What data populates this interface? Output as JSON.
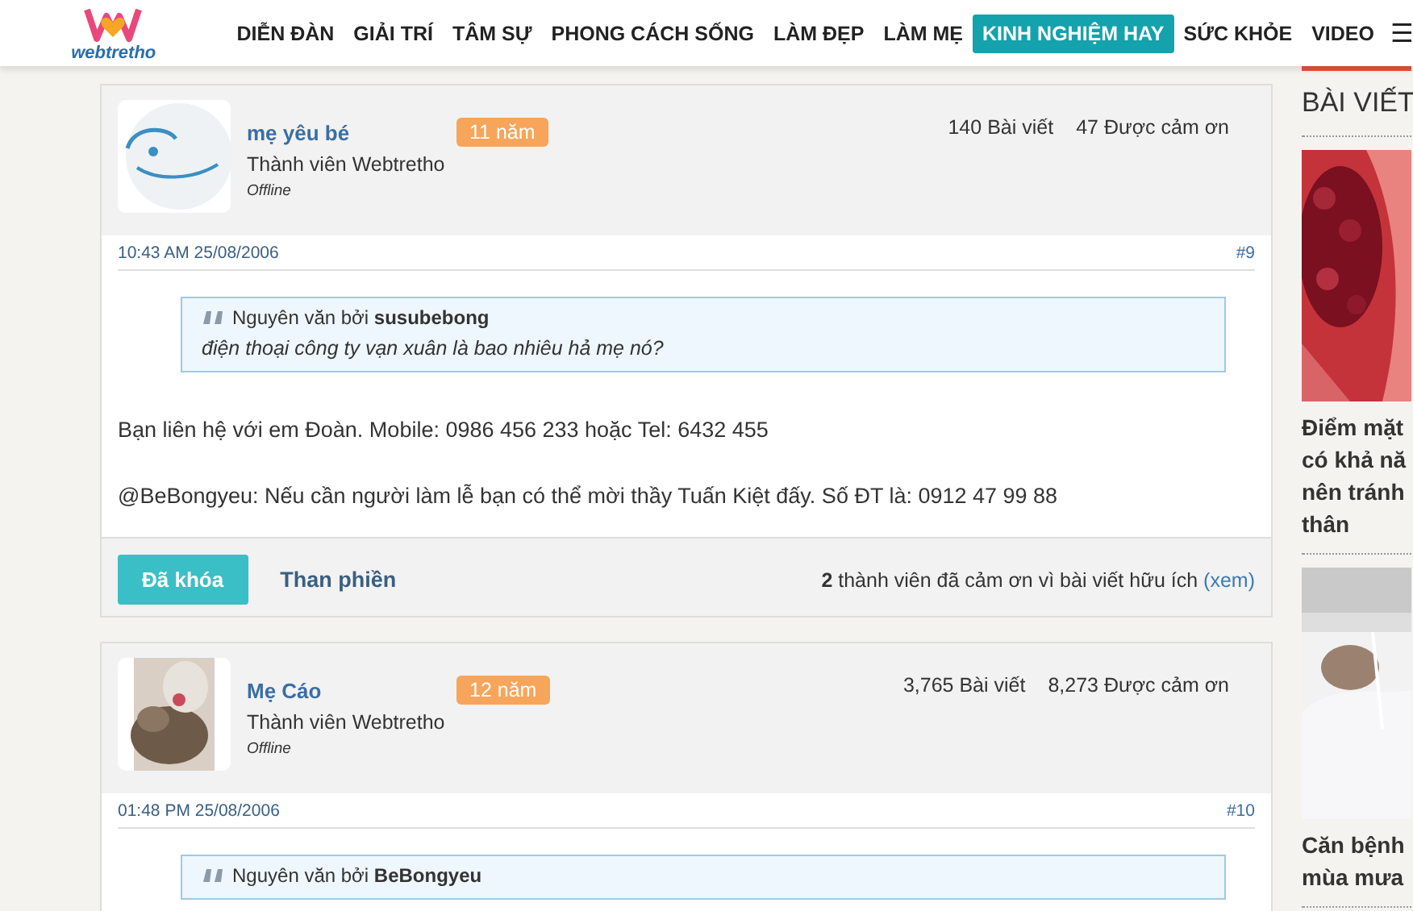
{
  "header": {
    "logo_text": "webtretho",
    "nav": [
      {
        "label": "DIỄN ĐÀN",
        "selected": false
      },
      {
        "label": "GIẢI TRÍ",
        "selected": false
      },
      {
        "label": "TÂM SỰ",
        "selected": false
      },
      {
        "label": "PHONG CÁCH SỐNG",
        "selected": false
      },
      {
        "label": "LÀM ĐẸP",
        "selected": false
      },
      {
        "label": "LÀM MẸ",
        "selected": false
      },
      {
        "label": "KINH NGHIỆM HAY",
        "selected": true
      },
      {
        "label": "SỨC KHỎE",
        "selected": false
      },
      {
        "label": "VIDEO",
        "selected": false
      }
    ],
    "menu_icon": "☰"
  },
  "posts": [
    {
      "username": "mẹ yêu bé",
      "rank": "Thành viên Webtretho",
      "status": "Offline",
      "badge": "11 năm",
      "posts_count": "140 Bài viết",
      "thanks_count": "47 Được cảm ơn",
      "time": "10:43 AM 25/08/2006",
      "number": "#9",
      "quote": {
        "prefix": "Nguyên văn bởi",
        "author": "susubebong",
        "text": "điện thoại công ty vạn xuân là bao nhiêu hả mẹ nó?"
      },
      "paragraphs": [
        "Bạn liên hệ với em Đoàn. Mobile: 0986 456 233 hoặc Tel: 6432 455",
        "@BeBongyeu: Nếu cần người làm lễ bạn có thể mời thầy Tuấn Kiệt đấy. Số ĐT là: 0912 47 99 88"
      ],
      "footer": {
        "locked_button": "Đã khóa",
        "report_link": "Than phiền",
        "thanks_text": "**2** thành viên đã cảm ơn vì bài viết hữu ích",
        "view_link": "(xem)"
      }
    },
    {
      "username": "Mẹ Cáo",
      "rank": "Thành viên Webtretho",
      "status": "Offline",
      "badge": "12 năm",
      "posts_count": "3,765 Bài viết",
      "thanks_count": "8,273 Được cảm ơn",
      "time": "01:48 PM 25/08/2006",
      "number": "#10",
      "quote": {
        "prefix": "Nguyên văn bởi",
        "author": "BeBongyeu"
      }
    }
  ],
  "sidebar": {
    "title": "BÀI VIẾT",
    "articles": [
      {
        "kind": "picture",
        "title_lines": [
          "Điểm mặt",
          "có khả nă",
          "nên tránh",
          "thân"
        ]
      },
      {
        "kind": "picture",
        "title_lines": [
          "Căn bệnh",
          "mùa mưa"
        ]
      }
    ]
  }
}
